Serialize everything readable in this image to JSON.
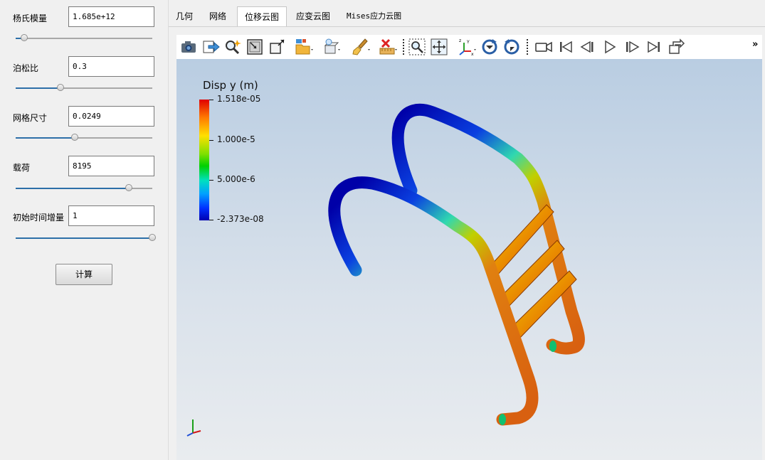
{
  "params": [
    {
      "label": "杨氏模量",
      "value": "1.685e+12",
      "slider": 0.06
    },
    {
      "label": "泊松比",
      "value": "0.3",
      "slider": 0.33
    },
    {
      "label": "网格尺寸",
      "value": "0.0249",
      "slider": 0.43
    },
    {
      "label": "载荷",
      "value": "8195",
      "slider": 0.83
    },
    {
      "label": "初始时间增量",
      "value": "1",
      "slider": 1.0
    }
  ],
  "calc_button": "计算",
  "tabs": [
    "几何",
    "网络",
    "位移云图",
    "应变云图",
    "Mises应力云图"
  ],
  "active_tab": "位移云图",
  "toolbar": {
    "buttons": [
      "camera-icon",
      "export-icon",
      "magnify-icon",
      "view-box-icon",
      "zoom-box-icon",
      "folder-open-icon",
      "light-icon",
      "brush-icon",
      "clear-icon",
      "zoom-to-box-icon",
      "fit-view-icon",
      "axes-orient-icon",
      "rotate-cw-icon",
      "rotate-ccw-icon",
      "video-camera-icon",
      "first-frame-icon",
      "prev-frame-icon",
      "play-icon",
      "next-frame-icon",
      "last-frame-icon",
      "loop-icon"
    ],
    "more": "»"
  },
  "legend": {
    "title": "Disp y (m)",
    "labels": [
      "1.518e-05",
      "1.000e-5",
      "5.000e-6",
      "-2.373e-08"
    ],
    "colors": {
      "max": "#e00000",
      "mid": "#00d000",
      "min": "#0000b0"
    }
  }
}
